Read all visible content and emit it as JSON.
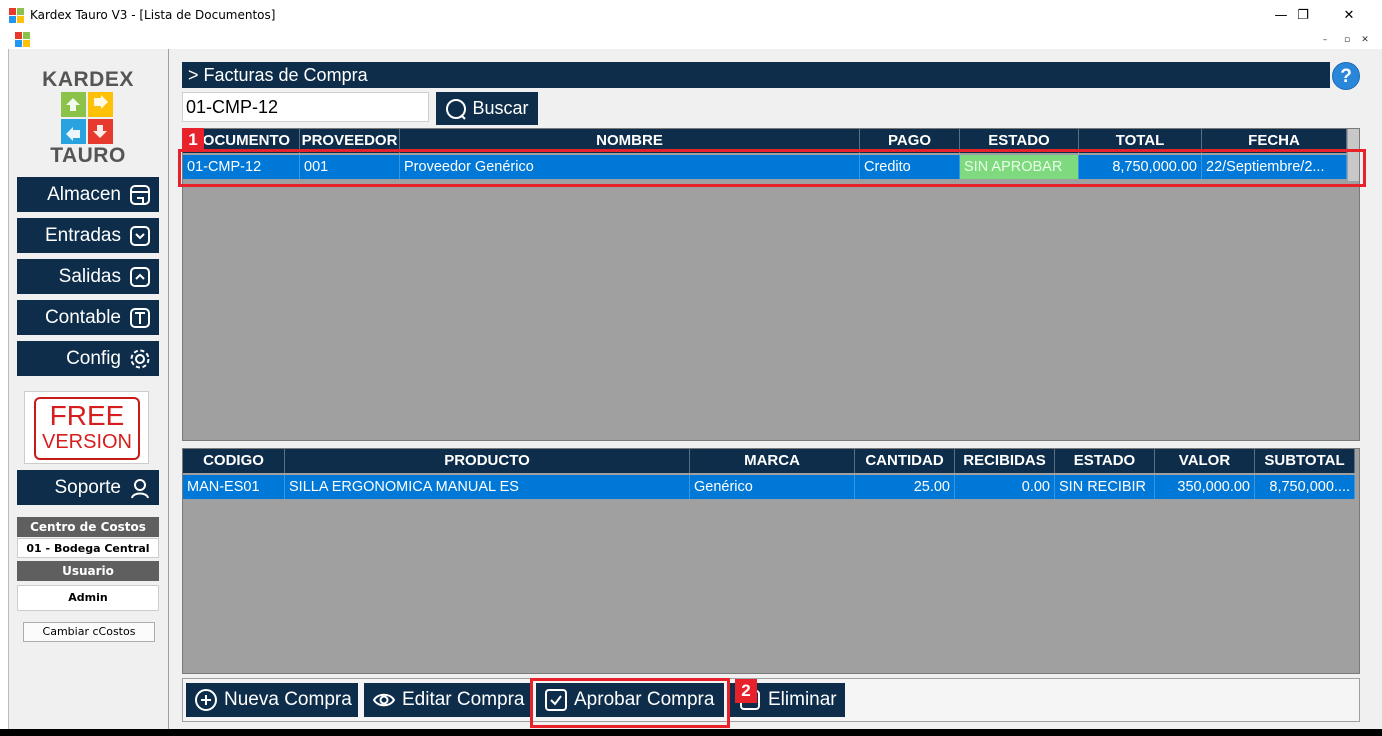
{
  "window": {
    "title": "Kardex Tauro V3 - [Lista de Documentos]",
    "minimize": "—",
    "maximize": "❐",
    "close": "✕"
  },
  "mdi": {
    "minimize": "–",
    "restore": "▫",
    "close": "✕"
  },
  "logo": {
    "top": "KARDEX",
    "bottom": "TAURO"
  },
  "sidebar": {
    "items": [
      {
        "label": "Almacen",
        "icon": "store-icon"
      },
      {
        "label": "Entradas",
        "icon": "inbox-down-icon"
      },
      {
        "label": "Salidas",
        "icon": "inbox-up-icon"
      },
      {
        "label": "Contable",
        "icon": "book-icon"
      },
      {
        "label": "Config",
        "icon": "gear-icon"
      }
    ],
    "free_line1": "FREE",
    "free_line2": "VERSION",
    "soporte": "Soporte",
    "centro_label": "Centro de Costos",
    "centro_value": "01 - Bodega Central",
    "usuario_label": "Usuario",
    "usuario_value": "Admin",
    "cambiar": "Cambiar cCostos"
  },
  "main": {
    "header": "> Facturas de Compra",
    "help": "?",
    "search_value": "01-CMP-12",
    "buscar": "Buscar"
  },
  "documents": {
    "columns": [
      "DOCUMENTO",
      "PROVEEDOR",
      "NOMBRE",
      "PAGO",
      "ESTADO",
      "TOTAL",
      "FECHA"
    ],
    "rows": [
      {
        "documento": "01-CMP-12",
        "proveedor": "001",
        "nombre": "Proveedor Genérico",
        "pago": "Credito",
        "estado": "SIN APROBAR",
        "total": "8,750,000.00",
        "fecha": "22/Septiembre/2..."
      }
    ]
  },
  "details": {
    "columns": [
      "CODIGO",
      "PRODUCTO",
      "MARCA",
      "CANTIDAD",
      "RECIBIDAS",
      "ESTADO",
      "VALOR",
      "SUBTOTAL"
    ],
    "rows": [
      {
        "codigo": "MAN-ES01",
        "producto": "SILLA ERGONOMICA MANUAL ES",
        "marca": "Genérico",
        "cantidad": "25.00",
        "recibidas": "0.00",
        "estado": "SIN RECIBIR",
        "valor": "350,000.00",
        "subtotal": "8,750,000...."
      }
    ]
  },
  "toolbar": {
    "nueva": "Nueva Compra",
    "editar": "Editar Compra",
    "aprobar": "Aprobar Compra",
    "eliminar": "Eliminar"
  },
  "annotations": {
    "tag1": "1",
    "tag2": "2",
    "color": "#e8222b"
  },
  "colors": {
    "navy": "#0d2d4a",
    "selection": "#0078d7",
    "approved_flag": "#7fd97f",
    "grid_bg": "#a0a0a0"
  }
}
